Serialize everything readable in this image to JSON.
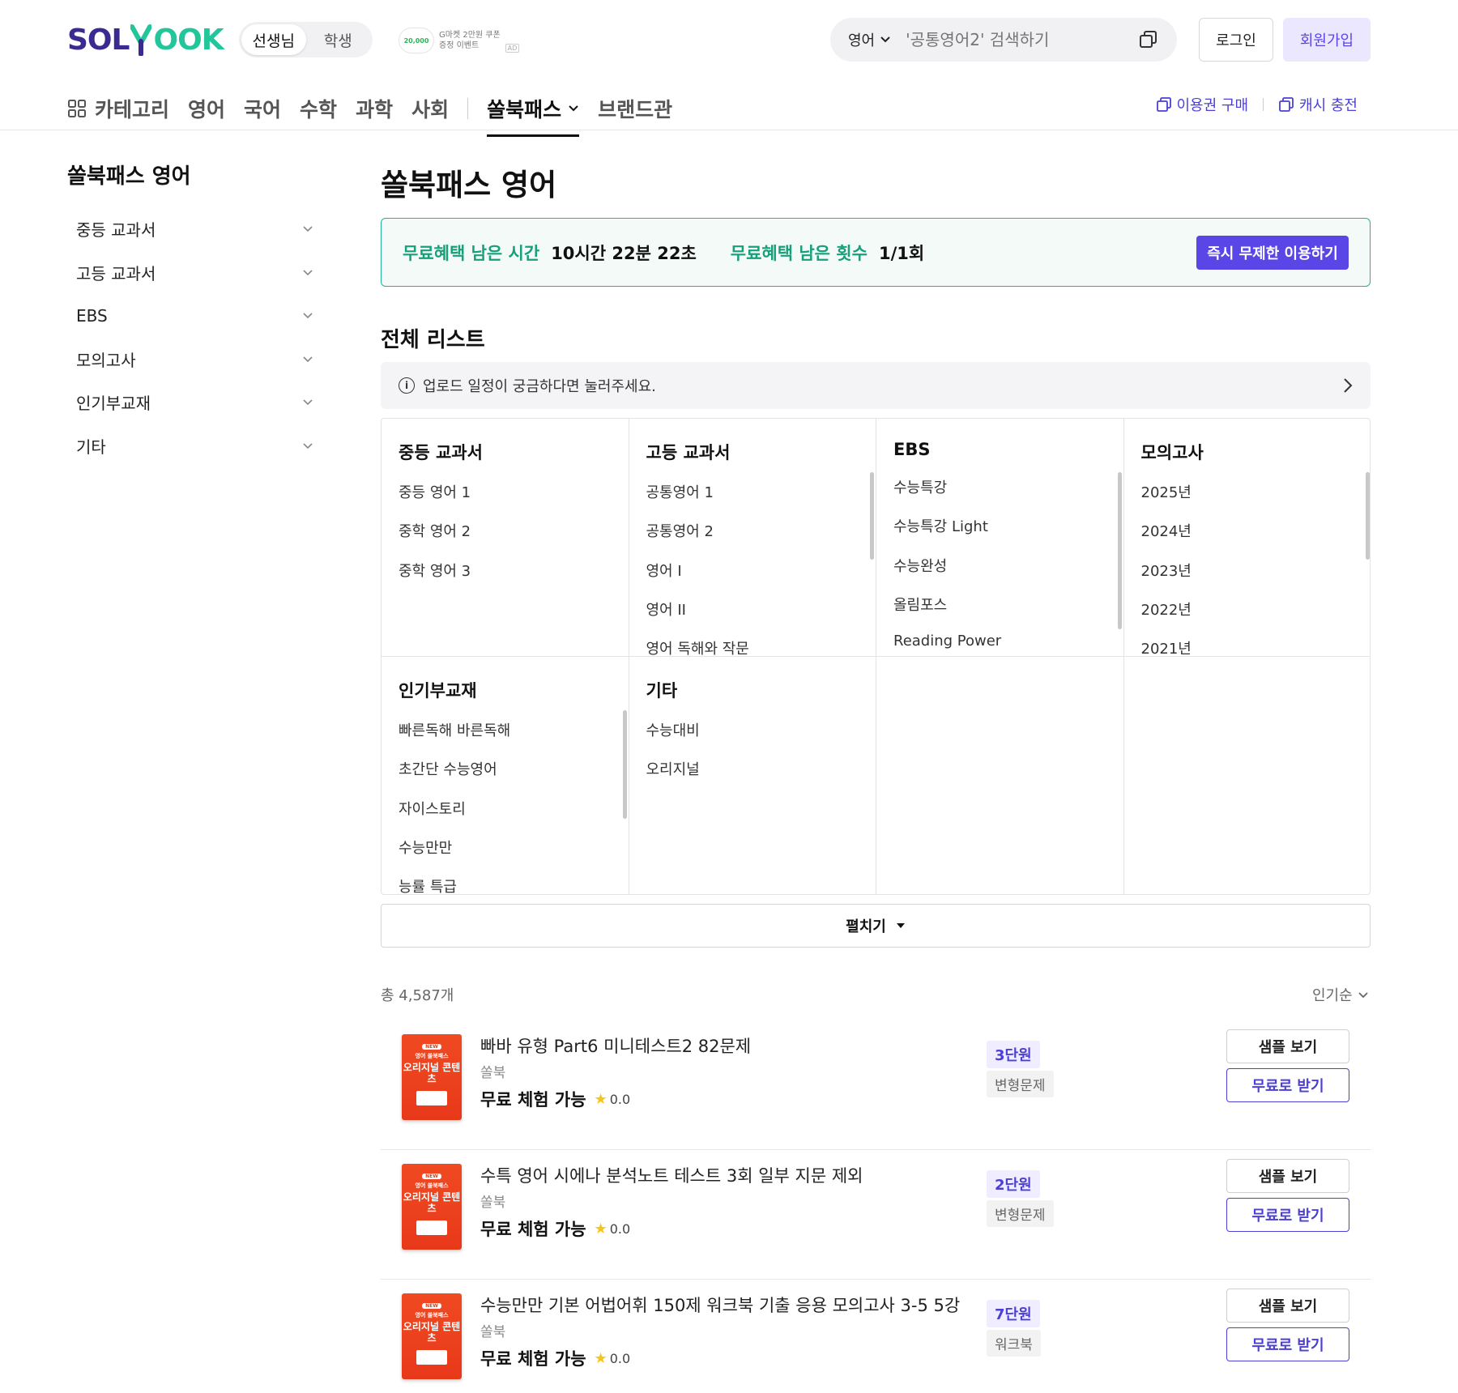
{
  "header": {
    "logo_left": "SOL",
    "logo_right": "OOK",
    "role_toggle": [
      "선생님",
      "학생"
    ],
    "ad": {
      "badge": "20,000",
      "line1": "G마켓 2만원 쿠폰",
      "line2": "증정 이벤트",
      "tag": "AD"
    },
    "search": {
      "subject": "영어",
      "placeholder": "'공통영어2' 검색하기"
    },
    "login": "로그인",
    "join": "회원가입"
  },
  "nav": {
    "category": "카테고리",
    "subjects": [
      "영어",
      "국어",
      "수학",
      "과학",
      "사회"
    ],
    "active": "쏠북패스",
    "brand": "브랜드관",
    "right": [
      "이용권 구매",
      "캐시 충전"
    ]
  },
  "sidebar": {
    "title": "쏠북패스 영어",
    "items": [
      "중등 교과서",
      "고등 교과서",
      "EBS",
      "모의고사",
      "인기부교재",
      "기타"
    ]
  },
  "main": {
    "title": "쏠북패스 영어",
    "benefit": {
      "time_label": "무료혜택 남은 시간",
      "time_value": "10시간 22분 22초",
      "count_label": "무료혜택 남은 횟수",
      "count_value": "1/1회",
      "button": "즉시 무제한 이용하기"
    },
    "list_title": "전체 리스트",
    "notice": "업로드 일정이 궁금하다면 눌러주세요.",
    "grid": [
      {
        "title": "중등 교과서",
        "items": [
          "중등 영어 1",
          "중학 영어 2",
          "중학 영어 3"
        ]
      },
      {
        "title": "고등 교과서",
        "items": [
          "공통영어 1",
          "공통영어 2",
          "영어 I",
          "영어 II",
          "영어 독해와 작문"
        ]
      },
      {
        "title": "EBS",
        "items": [
          "수능특강",
          "수능특강 Light",
          "수능완성",
          "올림포스",
          "Reading Power"
        ]
      },
      {
        "title": "모의고사",
        "items": [
          "2025년",
          "2024년",
          "2023년",
          "2022년",
          "2021년"
        ]
      },
      {
        "title": "인기부교재",
        "items": [
          "빠른독해 바른독해",
          "초간단 수능영어",
          "자이스토리",
          "수능만만",
          "능률 특급"
        ]
      },
      {
        "title": "기타",
        "items": [
          "수능대비",
          "오리지널"
        ]
      }
    ],
    "expand": "펼치기",
    "total": "총 4,587개",
    "sort": "인기순",
    "products": [
      {
        "name": "빠바 유형 Part6 미니테스트2 82문제",
        "publisher": "쏠북",
        "free": "무료 체험 가능",
        "rating": "0.0",
        "units": "3단원",
        "kind": "변형문제",
        "sample": "샘플 보기",
        "get": "무료로 받기",
        "cover": {
          "tag": "NEW",
          "sub": "영어 쏠북패스",
          "main": "오리지널 콘텐츠"
        }
      },
      {
        "name": "수특 영어 시에나 분석노트 테스트 3회 일부 지문 제외",
        "publisher": "쏠북",
        "free": "무료 체험 가능",
        "rating": "0.0",
        "units": "2단원",
        "kind": "변형문제",
        "sample": "샘플 보기",
        "get": "무료로 받기",
        "cover": {
          "tag": "NEW",
          "sub": "영어 쏠북패스",
          "main": "오리지널 콘텐츠"
        }
      },
      {
        "name": "수능만만 기본 어법어휘 150제 워크북 기출 응용 모의고사 3-5 5강",
        "publisher": "쏠북",
        "free": "무료 체험 가능",
        "rating": "0.0",
        "units": "7단원",
        "kind": "워크북",
        "sample": "샘플 보기",
        "get": "무료로 받기",
        "cover": {
          "tag": "NEW",
          "sub": "영어 쏠북패스",
          "main": "오리지널 콘텐츠"
        }
      }
    ]
  },
  "colors": {
    "brand_purple": "#5a45e6",
    "brand_green": "#21b58e",
    "logo_navy": "#3b2a8f"
  }
}
